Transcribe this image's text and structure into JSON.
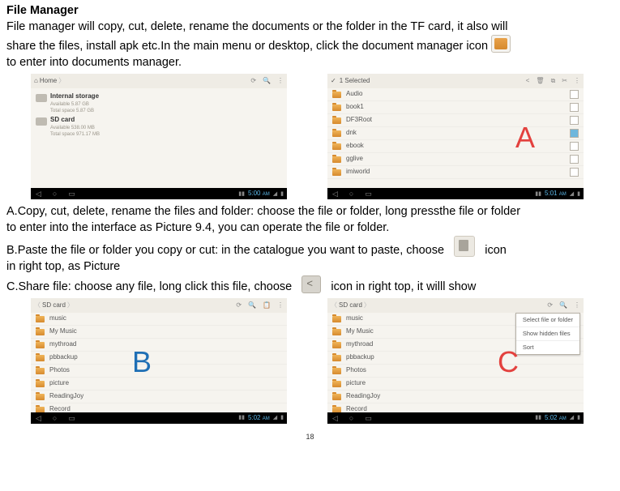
{
  "title": "File Manager",
  "intro_1": "File manager will copy, cut, delete, rename the documents or the folder in the TF card, it also will",
  "intro_2a": "share the files, install apk etc.In the main menu or desktop, click the document manager icon",
  "intro_3": "to enter into documents manager.",
  "section_a": "A.Copy, cut, delete, rename the files and folder: choose the file or folder, long pressthe file or folder",
  "section_a2": " to enter into the interface as Picture 9.4, you can operate the file or folder.",
  "section_b_1": "B.Paste the file or folder you copy or cut: in the catalogue you want to paste, choose",
  "section_b_2": "icon",
  "section_b_3": " in right top, as Picture",
  "section_c_1": "C.Share file: choose any file, long click this file, choose",
  "section_c_2": "icon in right top, it willl show",
  "page_number": "18",
  "shotA_left": {
    "crumb": "Home",
    "storage_items": [
      {
        "title": "Internal storage",
        "line1": "Available 5.87 GB",
        "line2": "Total space 5.87 GB"
      },
      {
        "title": "SD card",
        "line1": "Available 538.00 MB",
        "line2": "Total space 971.17 MB"
      }
    ],
    "clock": "5:00",
    "ampm": "AM"
  },
  "shotA_right": {
    "selected": "1 Selected",
    "items": [
      "Audio",
      "book1",
      "DF3Root",
      "dnk",
      "ebook",
      "gglive",
      "imiworld"
    ],
    "checked_index": 3,
    "clock": "5:01",
    "ampm": "AM"
  },
  "shotB": {
    "crumb": "SD card",
    "items": [
      "music",
      "My Music",
      "mythroad",
      "pbbackup",
      "Photos",
      "picture",
      "ReadingJoy",
      "Record"
    ],
    "clock": "5:02",
    "ampm": "AM"
  },
  "shotC": {
    "crumb": "SD card",
    "items": [
      "music",
      "My Music",
      "mythroad",
      "pbbackup",
      "Photos",
      "picture",
      "ReadingJoy",
      "Record"
    ],
    "menu": [
      "Select file or folder",
      "Show hidden files",
      "Sort"
    ],
    "clock": "5:02",
    "ampm": "AM"
  },
  "letters": {
    "a": "A",
    "b": "B",
    "c": "C"
  }
}
